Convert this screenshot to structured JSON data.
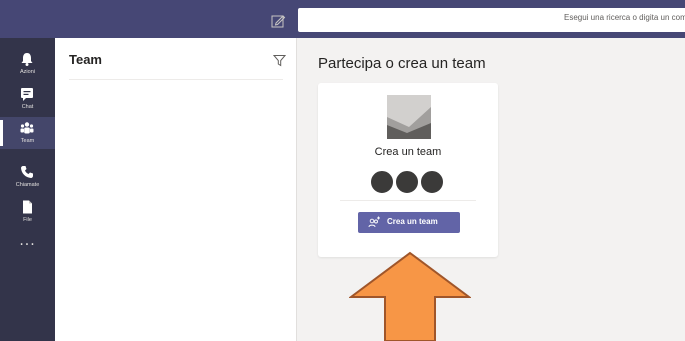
{
  "header": {
    "search_placeholder": "Esegui una ricerca o digita un comando"
  },
  "rail": {
    "items": [
      {
        "label": "Azioni",
        "icon": "bell-icon"
      },
      {
        "label": "Chat",
        "icon": "chat-icon"
      },
      {
        "label": "Team",
        "icon": "team-icon",
        "active": true
      },
      {
        "label": "Chiamate",
        "icon": "phone-icon"
      },
      {
        "label": "File",
        "icon": "file-icon"
      }
    ],
    "more_label": "···"
  },
  "list_panel": {
    "title": "Team",
    "filter_icon": "filter-icon"
  },
  "main": {
    "title": "Partecipa o crea un team",
    "card": {
      "title": "Crea un team",
      "button_label": "Crea un team",
      "button_icon": "add-people-icon"
    }
  },
  "annotation": {
    "type": "up-arrow",
    "fill": "#f79646",
    "stroke": "#a0562a"
  },
  "colors": {
    "header": "#464775",
    "rail": "#33344a",
    "accent": "#6264a7"
  }
}
